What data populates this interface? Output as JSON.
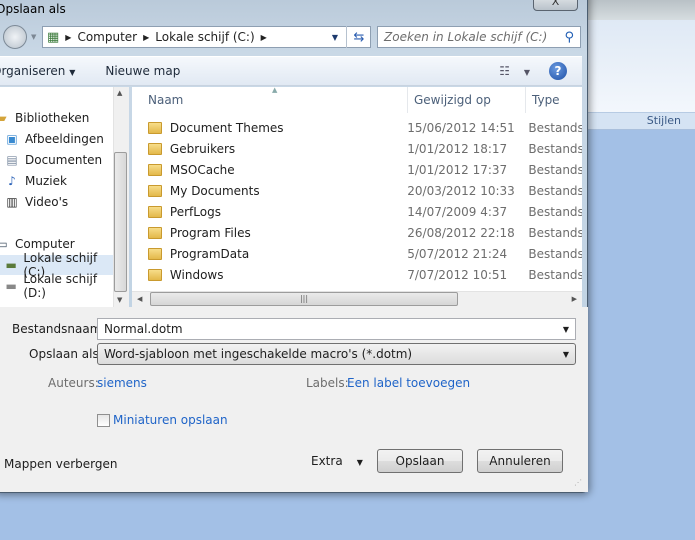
{
  "window": {
    "title": "Opslaan als",
    "close": "X"
  },
  "background": {
    "ribbon_group": "Stijlen"
  },
  "address": {
    "crumbs": [
      "Computer",
      "Lokale schijf (C:)"
    ],
    "search_placeholder": "Zoeken in Lokale schijf (C:)"
  },
  "toolbar": {
    "organize": "Organiseren",
    "new_folder": "Nieuwe map",
    "help": "?"
  },
  "nav": {
    "items": [
      {
        "label": "Bibliotheken",
        "icon": "library-icon"
      },
      {
        "label": "Afbeeldingen",
        "icon": "pictures-icon"
      },
      {
        "label": "Documenten",
        "icon": "documents-icon"
      },
      {
        "label": "Muziek",
        "icon": "music-icon"
      },
      {
        "label": "Video's",
        "icon": "video-icon"
      },
      {
        "label": "Computer",
        "icon": "computer-icon"
      },
      {
        "label": "Lokale schijf (C:)",
        "icon": "drive-icon"
      },
      {
        "label": "Lokale schijf (D:)",
        "icon": "drive-icon"
      }
    ]
  },
  "list": {
    "columns": [
      "Naam",
      "Gewijzigd op",
      "Type"
    ],
    "rows": [
      {
        "name": "Document Themes",
        "date": "15/06/2012 14:51",
        "type": "Bestandsmap"
      },
      {
        "name": "Gebruikers",
        "date": "1/01/2012 18:17",
        "type": "Bestandsmap"
      },
      {
        "name": "MSOCache",
        "date": "1/01/2012 17:37",
        "type": "Bestandsmap"
      },
      {
        "name": "My Documents",
        "date": "20/03/2012 10:33",
        "type": "Bestandsmap"
      },
      {
        "name": "PerfLogs",
        "date": "14/07/2009 4:37",
        "type": "Bestandsmap"
      },
      {
        "name": "Program Files",
        "date": "26/08/2012 22:18",
        "type": "Bestandsmap"
      },
      {
        "name": "ProgramData",
        "date": "5/07/2012 21:24",
        "type": "Bestandsmap"
      },
      {
        "name": "Windows",
        "date": "7/07/2012 10:51",
        "type": "Bestandsmap"
      }
    ]
  },
  "form": {
    "filename_label": "Bestandsnaam:",
    "filename": "Normal.dotm",
    "savetype_label": "Opslaan als:",
    "savetype": "Word-sjabloon met ingeschakelde macro's (*.dotm)",
    "authors_label": "Auteurs:",
    "authors": "siemens",
    "tags_label": "Labels:",
    "tags": "Een label toevoegen",
    "thumbnails": "Miniaturen opslaan"
  },
  "footer": {
    "hide_folders": "Mappen verbergen",
    "tools": "Extra",
    "save": "Opslaan",
    "cancel": "Annuleren"
  }
}
